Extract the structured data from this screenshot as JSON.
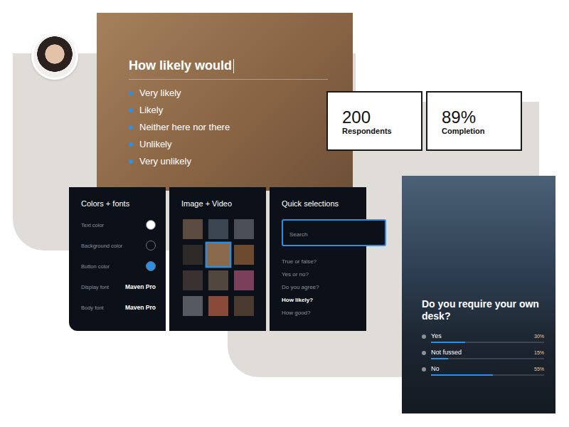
{
  "question": {
    "title": "How likely would",
    "options": [
      "Very likely",
      "Likely",
      "Neither here nor there",
      "Unlikely",
      "Very unlikely"
    ]
  },
  "stats": [
    {
      "value": "200",
      "label": "Respondents"
    },
    {
      "value": "89%",
      "label": "Completion"
    }
  ],
  "colors_fonts": {
    "title": "Colors + fonts",
    "swatches": [
      {
        "label": "Text color",
        "color": "#ffffff"
      },
      {
        "label": "Background color",
        "color": "#0b0f16"
      },
      {
        "label": "Button color",
        "color": "#2f8fe0"
      }
    ],
    "fonts": [
      {
        "label": "Display font",
        "value": "Maven Pro"
      },
      {
        "label": "Body font",
        "value": "Maven Pro"
      }
    ]
  },
  "media": {
    "title": "Image + Video",
    "thumbnails": [
      {
        "selected": false,
        "color": "#5a4a40"
      },
      {
        "selected": false,
        "color": "#3c4552"
      },
      {
        "selected": false,
        "color": "#4a4f57"
      },
      {
        "selected": false,
        "color": "#2e2a28"
      },
      {
        "selected": true,
        "color": "#8a6a4c"
      },
      {
        "selected": false,
        "color": "#6b4a30"
      },
      {
        "selected": false,
        "color": "#3a3230"
      },
      {
        "selected": false,
        "color": "#51473e"
      },
      {
        "selected": false,
        "color": "#7a3f5a"
      },
      {
        "selected": false,
        "color": "#555a60"
      },
      {
        "selected": false,
        "color": "#8a4a3a"
      },
      {
        "selected": false,
        "color": "#4a3a30"
      }
    ]
  },
  "quick_selections": {
    "title": "Quick selections",
    "search_placeholder": "Search",
    "items": [
      {
        "label": "True or false?",
        "selected": false
      },
      {
        "label": "Yes or no?",
        "selected": false
      },
      {
        "label": "Do you agree?",
        "selected": false
      },
      {
        "label": "How likely?",
        "selected": true
      },
      {
        "label": "How good?",
        "selected": false
      }
    ]
  },
  "poll": {
    "question": "Do you require your own desk?",
    "options": [
      {
        "label": "Yes",
        "reading": "30%",
        "level": 0.3
      },
      {
        "label": "Not fussed",
        "reading": "15%",
        "level": 0.15
      },
      {
        "label": "No",
        "reading": "55%",
        "level": 0.55
      }
    ]
  }
}
